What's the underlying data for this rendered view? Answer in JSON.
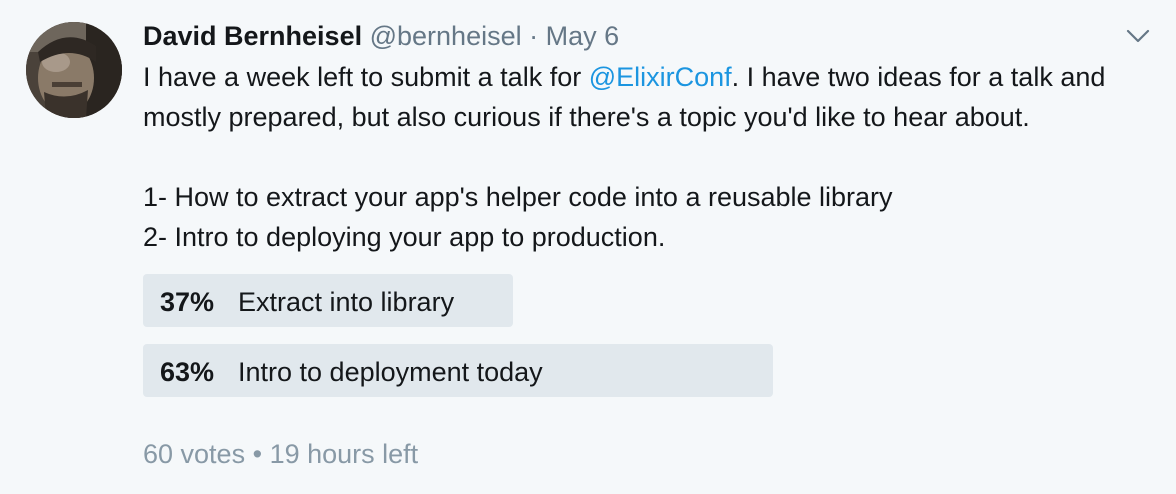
{
  "author": {
    "name": "David Bernheisel",
    "handle": "@bernheisel",
    "separator": "·",
    "date": "May 6"
  },
  "icons": {
    "menu": "chevron-down-icon",
    "avatar": "profile-photo"
  },
  "colors": {
    "background": "#f5f8fa",
    "text": "#14171a",
    "secondary": "#657786",
    "link": "#1b95e0",
    "poll_bar": "#e1e8ed",
    "footer": "#8899a6"
  },
  "tweet": {
    "line1_before": "I have a week left to submit a talk for ",
    "mention": "@ElixirConf",
    "line1_after": ". I have two ideas for a talk and mostly prepared, but also curious if there's a topic you'd like to hear about.",
    "item1": "1- How to extract your app's helper code into a reusable library",
    "item2": "2- Intro to deploying your app to production."
  },
  "poll": {
    "choices": [
      {
        "percent_label": "37%",
        "label": "Extract into library",
        "percent": 37
      },
      {
        "percent_label": "63%",
        "label": "Intro to deployment today",
        "percent": 63
      }
    ],
    "votes": "60 votes",
    "bullet": "•",
    "time_left": "19 hours left"
  }
}
